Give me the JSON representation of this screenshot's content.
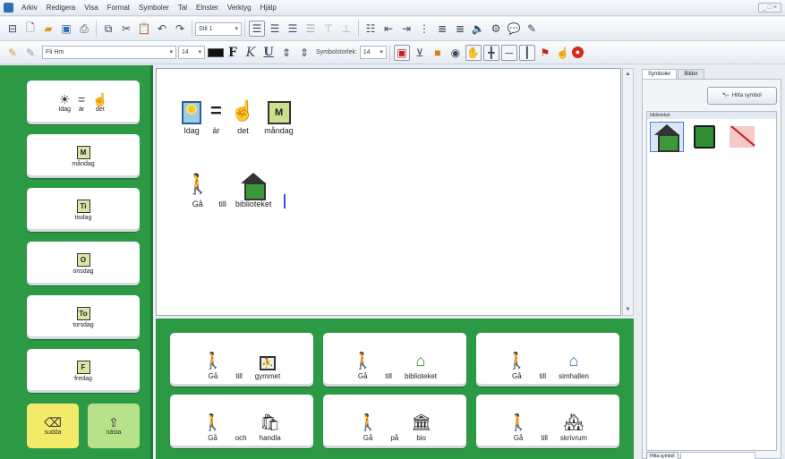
{
  "menu": {
    "items": [
      "Arkiv",
      "Redigera",
      "Visa",
      "Format",
      "Symboler",
      "Tal",
      "Elnster",
      "Verktyg",
      "Hjälp"
    ],
    "window_controls": "_ □ ×"
  },
  "toolbar1": {
    "style_combo": "Stil 1",
    "icons": [
      "new-document-icon",
      "open-folder-icon",
      "save-icon",
      "print-icon",
      "copy-icon",
      "cut-icon",
      "paste-icon",
      "undo-icon",
      "redo-icon"
    ]
  },
  "toolbar2": {
    "font_combo": "Fli Hm",
    "font_size": "14",
    "bold": "F",
    "italic": "K",
    "underline": "U",
    "symbol_size_label": "Symbolstorlek:",
    "symbol_size": "14"
  },
  "left_panel": {
    "cards": [
      {
        "type": "equation",
        "words": [
          "Idag",
          "är",
          "det"
        ]
      },
      {
        "type": "day",
        "symbol": "M",
        "label": "måndag"
      },
      {
        "type": "day",
        "symbol": "Ti",
        "label": "tisdag"
      },
      {
        "type": "day",
        "symbol": "O",
        "label": "onsdag"
      },
      {
        "type": "day",
        "symbol": "To",
        "label": "torsdag"
      },
      {
        "type": "day",
        "symbol": "F",
        "label": "fredag"
      }
    ],
    "btn_yellow": "sudda",
    "btn_green": "nästa"
  },
  "editor": {
    "line1": [
      {
        "word": "Idag",
        "icon": "sun-icon"
      },
      {
        "word": "är",
        "icon": "equals-icon"
      },
      {
        "word": "det",
        "icon": "point-hand-icon"
      },
      {
        "word": "måndag",
        "icon": "monday-icon"
      }
    ],
    "line2": [
      {
        "word": "Gå",
        "icon": "walking-person-icon"
      },
      {
        "word": "till",
        "icon": ""
      },
      {
        "word": "biblioteket",
        "icon": "library-icon"
      }
    ]
  },
  "phrases": [
    {
      "words": [
        "Gå",
        "till",
        "gymmet"
      ],
      "icons": [
        "walking-person-icon",
        "",
        "gym-icon"
      ]
    },
    {
      "words": [
        "Gå",
        "till",
        "biblioteket"
      ],
      "icons": [
        "walking-person-icon",
        "",
        "library-icon"
      ]
    },
    {
      "words": [
        "Gå",
        "till",
        "simhallen"
      ],
      "icons": [
        "walking-person-icon",
        "",
        "swimming-hall-icon"
      ]
    },
    {
      "words": [
        "Gå",
        "och",
        "handla"
      ],
      "icons": [
        "walking-person-icon",
        "",
        "shopping-icon"
      ]
    },
    {
      "words": [
        "Gå",
        "på",
        "bio"
      ],
      "icons": [
        "walking-person-icon",
        "",
        "cinema-icon"
      ]
    },
    {
      "words": [
        "Gå",
        "till",
        "skrivrum"
      ],
      "icons": [
        "walking-person-icon",
        "",
        "workshop-icon"
      ]
    }
  ],
  "right_panel": {
    "tabs": [
      "Symboler",
      "Bilder"
    ],
    "find_button": "Hitta symbol",
    "results_header": "biblioteket",
    "footer_button": "Hitta symbol"
  },
  "colors": {
    "panel_green": "#2c9a45",
    "accent_blue": "#2f6fb3",
    "cursor": "#4646d8"
  }
}
